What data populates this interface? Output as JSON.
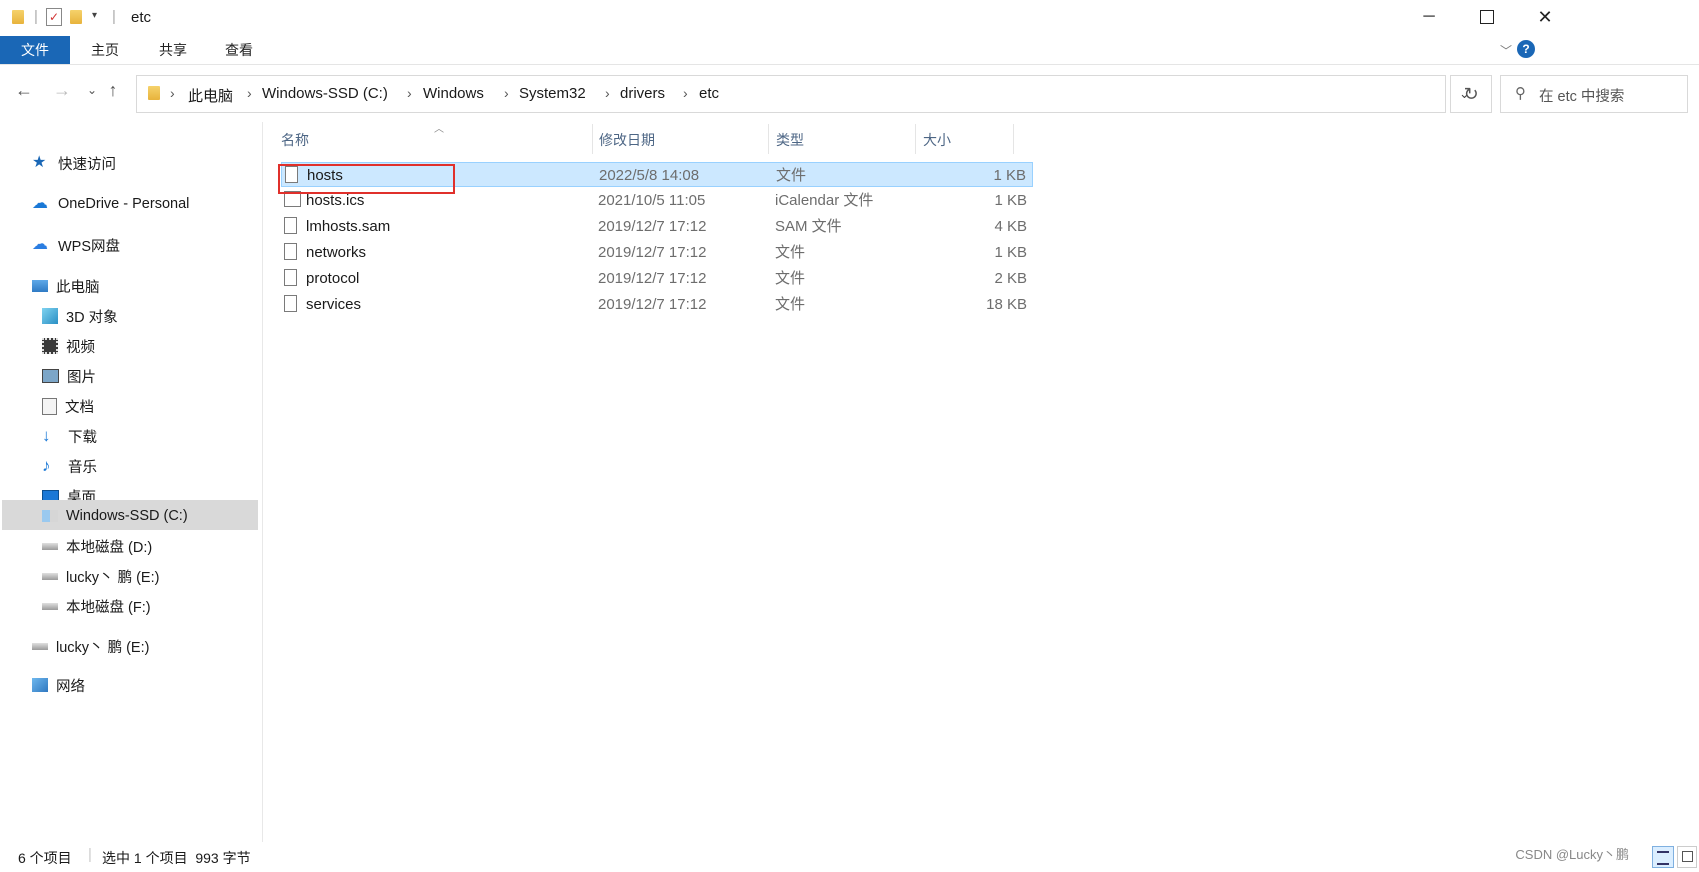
{
  "window": {
    "title": "etc",
    "minimize_icon": "minimize-icon",
    "maximize_icon": "maximize-icon",
    "close_icon": "close-icon"
  },
  "ribbon": {
    "tabs": [
      "文件",
      "主页",
      "共享",
      "查看"
    ]
  },
  "address": {
    "crumbs": [
      "此电脑",
      "Windows-SSD (C:)",
      "Windows",
      "System32",
      "drivers",
      "etc"
    ],
    "search_placeholder": "在 etc 中搜索"
  },
  "nav": {
    "quick_access": "快速访问",
    "onedrive": "OneDrive - Personal",
    "wps": "WPS网盘",
    "this_pc": "此电脑",
    "pc_items": [
      "3D 对象",
      "视频",
      "图片",
      "文档",
      "下载",
      "音乐",
      "桌面",
      "Windows-SSD (C:)",
      "本地磁盘 (D:)",
      "lucky丶 鹏 (E:)",
      "本地磁盘 (F:)"
    ],
    "lucky": "lucky丶 鹏 (E:)",
    "network": "网络"
  },
  "columns": {
    "name": "名称",
    "modified": "修改日期",
    "type": "类型",
    "size": "大小"
  },
  "files": [
    {
      "name": "hosts",
      "modified": "2022/5/8 14:08",
      "type": "文件",
      "size": "1 KB"
    },
    {
      "name": "hosts.ics",
      "modified": "2021/10/5 11:05",
      "type": "iCalendar 文件",
      "size": "1 KB"
    },
    {
      "name": "lmhosts.sam",
      "modified": "2019/12/7 17:12",
      "type": "SAM 文件",
      "size": "4 KB"
    },
    {
      "name": "networks",
      "modified": "2019/12/7 17:12",
      "type": "文件",
      "size": "1 KB"
    },
    {
      "name": "protocol",
      "modified": "2019/12/7 17:12",
      "type": "文件",
      "size": "2 KB"
    },
    {
      "name": "services",
      "modified": "2019/12/7 17:12",
      "type": "文件",
      "size": "18 KB"
    }
  ],
  "status": {
    "count": "6 个项目",
    "selection": "选中 1 个项目  993 字节"
  },
  "watermark": "CSDN @Lucky丶鹏"
}
